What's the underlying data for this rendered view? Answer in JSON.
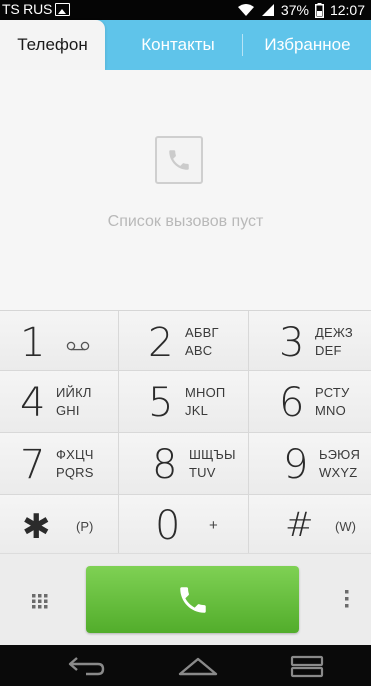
{
  "status_bar": {
    "carrier": "TS RUS",
    "battery": "37%",
    "time": "12:07"
  },
  "tabs": [
    {
      "label": "Телефон",
      "active": true
    },
    {
      "label": "Контакты",
      "active": false
    },
    {
      "label": "Избранное",
      "active": false
    }
  ],
  "call_log": {
    "empty_message": "Список вызовов пуст"
  },
  "keypad": {
    "keys": [
      {
        "digit": "1",
        "symbol": "voicemail-icon"
      },
      {
        "digit": "2",
        "cyr": "АБВГ",
        "lat": "ABC"
      },
      {
        "digit": "3",
        "cyr": "ДЕЖЗ",
        "lat": "DEF"
      },
      {
        "digit": "4",
        "cyr": "ИЙКЛ",
        "lat": "GHI"
      },
      {
        "digit": "5",
        "cyr": "МНОП",
        "lat": "JKL"
      },
      {
        "digit": "6",
        "cyr": "РСТУ",
        "lat": "MNO"
      },
      {
        "digit": "7",
        "cyr": "ФХЦЧ",
        "lat": "PQRS"
      },
      {
        "digit": "8",
        "cyr": "ШЩЪЫ",
        "lat": "TUV"
      },
      {
        "digit": "9",
        "cyr": "ЬЭЮЯ",
        "lat": "WXYZ"
      },
      {
        "digit": "✱",
        "sub": "(P)"
      },
      {
        "digit": "0",
        "sub": "+"
      },
      {
        "digit": "#",
        "sub": "(W)"
      }
    ]
  },
  "colors": {
    "tab_bar": "#5fc4ea",
    "call_button": "#5fbf36",
    "status_bar": "#050505"
  },
  "icons": {
    "call_button": "phone-icon",
    "left_action": "dialpad-grid-icon",
    "right_action": "overflow-menu-icon",
    "empty_log": "phone-icon",
    "nav": [
      "back-icon",
      "home-icon",
      "recent-apps-icon"
    ]
  }
}
